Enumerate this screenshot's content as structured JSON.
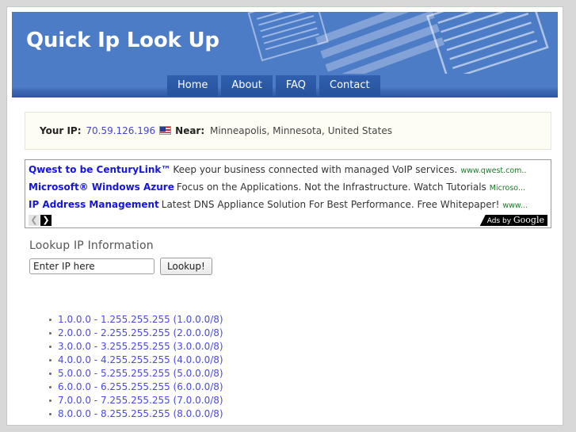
{
  "site": {
    "title": "Quick Ip Look Up"
  },
  "nav": {
    "items": [
      {
        "label": "Home",
        "name": "nav-item-home"
      },
      {
        "label": "About",
        "name": "nav-item-about"
      },
      {
        "label": "FAQ",
        "name": "nav-item-faq"
      },
      {
        "label": "Contact",
        "name": "nav-item-contact"
      }
    ]
  },
  "ip_info": {
    "your_ip_label": "Your IP:",
    "ip_address": "70.59.126.196",
    "flag_icon": "us-flag-icon",
    "near_label": "Near:",
    "location": "Minneapolis, Minnesota, United States"
  },
  "ads": {
    "rows": [
      {
        "title": "Qwest to be CenturyLink™",
        "description": "Keep your business connected with managed VoIP services.",
        "url": "www.qwest.com.."
      },
      {
        "title": "Microsoft® Windows Azure",
        "description": "Focus on the Applications. Not the Infrastructure. Watch Tutorials",
        "url": "Microso..."
      },
      {
        "title": "IP Address Management",
        "description": "Latest DNS Appliance Solution For Best Performance. Free Whitepaper!",
        "url": "www..."
      }
    ],
    "prev_arrow": "❮",
    "next_arrow": "❯",
    "badge_prefix": "Ads by ",
    "badge_brand": "Google"
  },
  "lookup": {
    "heading": "Lookup IP Information",
    "input_value": "Enter IP here",
    "input_placeholder": "Enter IP here",
    "button_label": "Lookup!"
  },
  "ranges": [
    "1.0.0.0 - 1.255.255.255 (1.0.0.0/8)",
    "2.0.0.0 - 2.255.255.255 (2.0.0.0/8)",
    "3.0.0.0 - 3.255.255.255 (3.0.0.0/8)",
    "4.0.0.0 - 4.255.255.255 (4.0.0.0/8)",
    "5.0.0.0 - 5.255.255.255 (5.0.0.0/8)",
    "6.0.0.0 - 6.255.255.255 (6.0.0.0/8)",
    "7.0.0.0 - 7.255.255.255 (7.0.0.0/8)",
    "8.0.0.0 - 8.255.255.255 (8.0.0.0/8)"
  ],
  "colors": {
    "header_blue": "#4d7cc7",
    "nav_tab_blue": "#2f5fae",
    "link_blue": "#4a4ae0",
    "ad_title_blue": "#1515dd",
    "ad_url_green": "#1a7a28",
    "info_box_bg": "#fdfdf3",
    "page_bg": "#d8d8d8"
  }
}
